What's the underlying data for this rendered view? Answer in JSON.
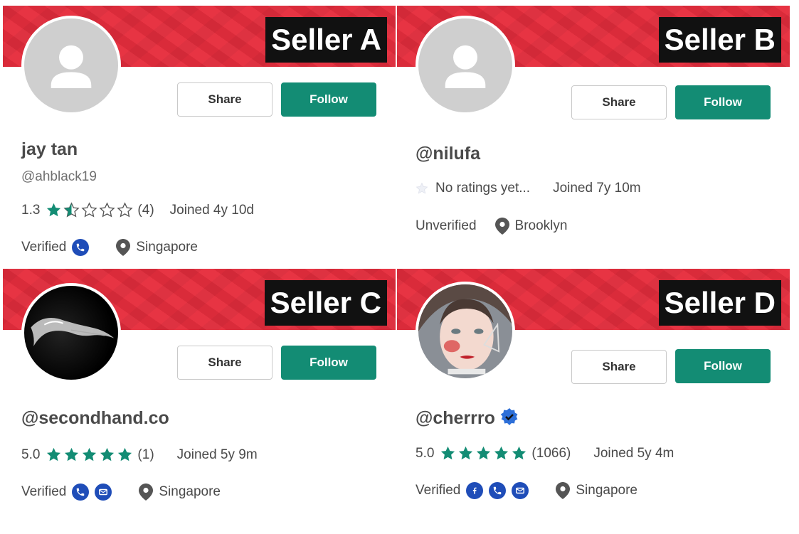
{
  "colors": {
    "banner": "#e62d3d",
    "follow": "#138c74",
    "star_filled": "#138c74",
    "verify_icon": "#1f4db8"
  },
  "sellers": [
    {
      "tag": "Seller A",
      "avatar": "default-user-icon",
      "share_label": "Share",
      "follow_label": "Follow",
      "name": "jay tan",
      "handle": "@ahblack19",
      "rating_value": "1.3",
      "stars": 1.5,
      "rating_count": "(4)",
      "joined": "Joined 4y 10d",
      "status": "Verified",
      "verifications": [
        "phone-icon"
      ],
      "location": "Singapore"
    },
    {
      "tag": "Seller B",
      "avatar": "default-user-icon",
      "share_label": "Share",
      "follow_label": "Follow",
      "name": "@nilufa",
      "no_ratings": "No ratings yet...",
      "joined": "Joined 7y 10m",
      "status": "Unverified",
      "verifications": [],
      "location": "Brooklyn"
    },
    {
      "tag": "Seller C",
      "avatar": "jaguar-logo-image",
      "share_label": "Share",
      "follow_label": "Follow",
      "name": "@secondhand.co",
      "rating_value": "5.0",
      "stars": 5,
      "rating_count": "(1)",
      "joined": "Joined 5y 9m",
      "status": "Verified",
      "verifications": [
        "phone-icon",
        "email-icon"
      ],
      "location": "Singapore"
    },
    {
      "tag": "Seller D",
      "avatar": "profile-photo",
      "share_label": "Share",
      "follow_label": "Follow",
      "name": "@cherrro",
      "verified_badge": "verified-badge-icon",
      "rating_value": "5.0",
      "stars": 5,
      "rating_count": "(1066)",
      "joined": "Joined 5y 4m",
      "status": "Verified",
      "verifications": [
        "facebook-icon",
        "phone-icon",
        "email-icon"
      ],
      "location": "Singapore"
    }
  ]
}
